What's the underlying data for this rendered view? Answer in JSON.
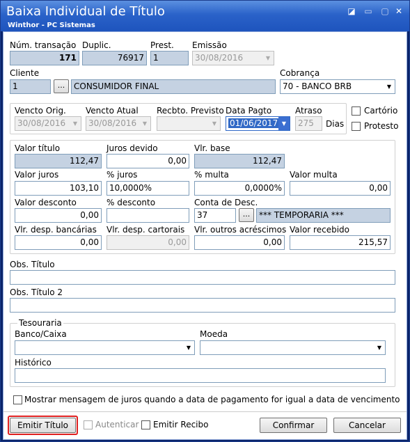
{
  "window": {
    "title": "Baixa Individual de Título",
    "subtitle": "Winthor - PC Sistemas",
    "controls": {
      "restore": "◪",
      "minimize": "▭",
      "close": "✕"
    }
  },
  "header": {
    "num_transacao_label": "Núm. transação",
    "num_transacao": "171",
    "duplic_label": "Duplic.",
    "duplic": "76917",
    "prest_label": "Prest.",
    "prest": "1",
    "emissao_label": "Emissão",
    "emissao": "30/08/2016"
  },
  "cliente": {
    "label": "Cliente",
    "code": "1",
    "browse": "...",
    "name": "CONSUMIDOR FINAL"
  },
  "cobranca": {
    "label": "Cobrança",
    "value": "70 - BANCO BRB"
  },
  "dates": {
    "vencto_orig_label": "Vencto Orig.",
    "vencto_orig": "30/08/2016",
    "vencto_atual_label": "Vencto Atual",
    "vencto_atual": "30/08/2016",
    "recbto_label": "Recbto. Previsto",
    "recbto": "",
    "data_pagto_label": "Data Pagto",
    "data_pagto": "01/06/2017",
    "atraso_label": "Atraso",
    "atraso": "275",
    "dias_label": "Dias"
  },
  "checks": {
    "cartorio": "Cartório",
    "protesto": "Protesto"
  },
  "values": {
    "valor_titulo_label": "Valor título",
    "valor_titulo": "112,47",
    "juros_devido_label": "Juros devido",
    "juros_devido": "0,00",
    "vlr_base_label": "Vlr. base",
    "vlr_base": "112,47",
    "valor_juros_label": "Valor juros",
    "valor_juros": "103,10",
    "pct_juros_label": "% juros",
    "pct_juros": "10,0000%",
    "pct_multa_label": "% multa",
    "pct_multa": "0,0000%",
    "valor_multa_label": "Valor multa",
    "valor_multa": "0,00",
    "valor_desconto_label": "Valor desconto",
    "valor_desconto": "0,00",
    "pct_desconto_label": "% desconto",
    "pct_desconto": "",
    "conta_desc_label": "Conta de Desc.",
    "conta_desc_code": "37",
    "conta_desc_browse": "...",
    "conta_desc_name": "*** TEMPORARIA ***",
    "desp_bancarias_label": "Vlr. desp. bancárias",
    "desp_bancarias": "0,00",
    "desp_cartorais_label": "Vlr. desp. cartorais",
    "desp_cartorais": "0,00",
    "outros_acrescimos_label": "Vlr. outros acréscimos",
    "outros_acrescimos": "0,00",
    "valor_recebido_label": "Valor recebido",
    "valor_recebido": "215,57"
  },
  "obs": {
    "obs_titulo_label": "Obs. Título",
    "obs_titulo": "",
    "obs_titulo2_label": "Obs. Título 2",
    "obs_titulo2": ""
  },
  "tesouraria": {
    "label": "Tesouraria",
    "banco_label": "Banco/Caixa",
    "banco": "",
    "moeda_label": "Moeda",
    "moeda": "",
    "historico_label": "Histórico",
    "historico": ""
  },
  "mostrar_msg": "Mostrar mensagem de juros quando a data de pagamento for igual a data de vencimento",
  "footer": {
    "emitir_titulo": "Emitir Título",
    "autenticar": "Autenticar",
    "emitir_recibo": "Emitir Recibo",
    "confirmar": "Confirmar",
    "cancelar": "Cancelar"
  }
}
